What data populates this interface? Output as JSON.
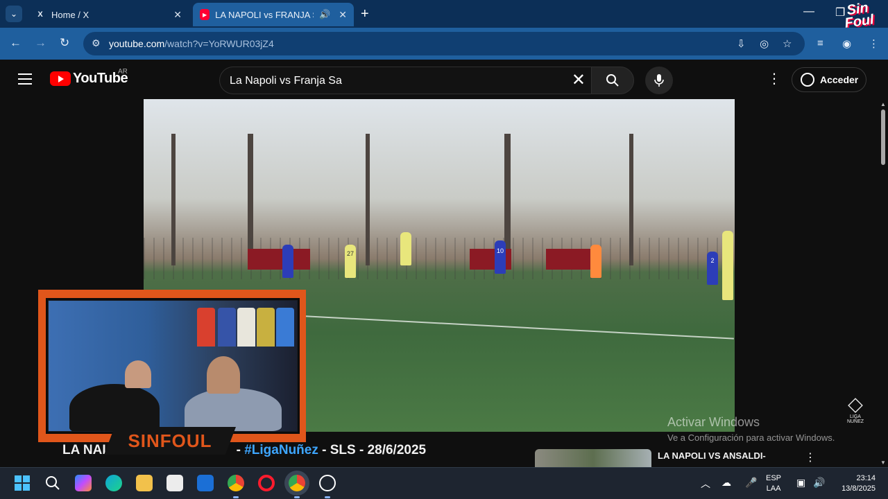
{
  "browser": {
    "tabs": [
      {
        "title": "Home / X",
        "favicon": "X"
      },
      {
        "title": "LA NAPOLI vs FRANJA S A",
        "favicon": "youtube"
      }
    ],
    "new_tab": "+",
    "url_host": "youtube.com",
    "url_path": "/watch?v=YoRWUR03jZ4",
    "brand_logo": "Sin Foul"
  },
  "youtube": {
    "logo_text": "YouTube",
    "region": "AR",
    "search_value": "La Napoli vs Franja Sa",
    "signin_label": "Acceder"
  },
  "video": {
    "title_visible_start": "LA NAI",
    "title_tag": "#LigaNuñez",
    "title_rest": " - SLS - 28/6/2025",
    "watermark": "LIGA NUÑEZ",
    "jersey_numbers": [
      "27",
      "10",
      "2"
    ]
  },
  "overlay": {
    "nameplate": "SINFOUL"
  },
  "related": {
    "title": "LA NAPOLI VS ANSALDI-"
  },
  "windows_activation": {
    "line1": "Activar Windows",
    "line2": "Ve a Configuración para activar Windows."
  },
  "taskbar": {
    "lang_line1": "ESP",
    "lang_line2": "LAA",
    "time": "23:14",
    "date": "13/8/2025"
  },
  "colors": {
    "tab_bar": "#0c2f57",
    "toolbar": "#1f5f9e",
    "youtube_red": "#ff0000",
    "overlay_orange": "#e0561b",
    "hashtag_blue": "#3ea6ff"
  }
}
